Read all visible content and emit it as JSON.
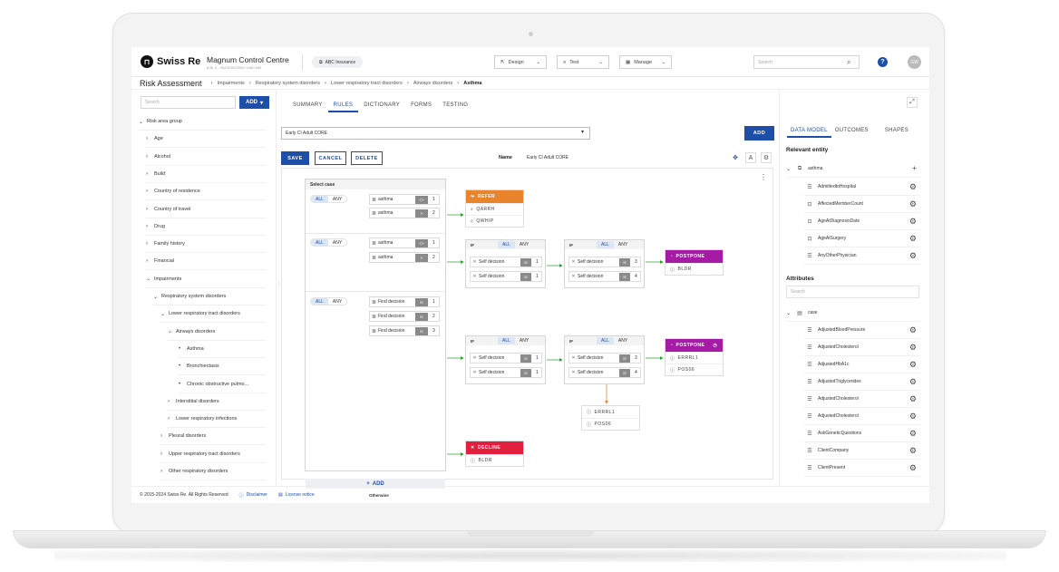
{
  "header": {
    "logo_text": "Swiss Re",
    "app_title": "Magnum Control Centre",
    "app_subtitle": "6.8L.3 - 20231002/200/+1440 ed2",
    "tenant": "ABC Insurance",
    "menus": [
      {
        "icon": "design-icon",
        "label": "Design"
      },
      {
        "icon": "test-icon",
        "label": "Test"
      },
      {
        "icon": "manage-icon",
        "label": "Manage"
      }
    ],
    "search_placeholder": "Search",
    "avatar_initials": "GW"
  },
  "breadcrumb": {
    "title": "Risk Assessment",
    "items": [
      "Impairments",
      "Respiratory system disorders",
      "Lower respiratory tract disorders",
      "Airways disorders",
      "Asthma"
    ]
  },
  "tree": {
    "search_placeholder": "Search",
    "add_label": "ADD",
    "items": [
      {
        "label": "Risk area group",
        "chev": "⌄"
      },
      {
        "label": "Age",
        "chev": "›"
      },
      {
        "label": "Alcohol",
        "chev": "›"
      },
      {
        "label": "Build",
        "chev": "›"
      },
      {
        "label": "Country of residence",
        "chev": "›"
      },
      {
        "label": "Country of travel",
        "chev": "›"
      },
      {
        "label": "Drug",
        "chev": "›"
      },
      {
        "label": "Family history",
        "chev": "›"
      },
      {
        "label": "Financial",
        "chev": "›"
      },
      {
        "label": "Impairments",
        "chev": "⌄"
      },
      {
        "label": "Respiratory system disorders",
        "chev": "⌄"
      },
      {
        "label": "Lower respiratory tract disorders",
        "chev": "⌄"
      },
      {
        "label": "Airways disorders",
        "chev": "⌄"
      },
      {
        "label": "Asthma",
        "chev": "•"
      },
      {
        "label": "Bronchiectasis",
        "chev": "•"
      },
      {
        "label": "Chronic obstructive pulmo...",
        "chev": "•"
      },
      {
        "label": "Interstitial disorders",
        "chev": "›"
      },
      {
        "label": "Lower respiratory infections",
        "chev": "›"
      },
      {
        "label": "Pleural disorders",
        "chev": "›"
      },
      {
        "label": "Upper respiratory tract disorders",
        "chev": "›"
      },
      {
        "label": "Other respiratory disorders",
        "chev": "›"
      }
    ]
  },
  "tabs": [
    "SUMMARY",
    "RULES",
    "DICTIONARY",
    "FORMS",
    "TESTING"
  ],
  "active_tab": "RULES",
  "rules": {
    "ruleset_value": "Early CI Adult CORE",
    "add_label": "ADD",
    "save_label": "SAVE",
    "cancel_label": "CANCEL",
    "delete_label": "DELETE",
    "name_label": "Name",
    "name_value": "Early CI Adult CORE"
  },
  "case_panel": {
    "title": "Select case",
    "all_label": "ALL",
    "any_label": "ANY",
    "groups": [
      {
        "conditions": [
          {
            "label": "asthma",
            "op": "<>",
            "num": "1"
          },
          {
            "label": "asthma",
            "op": ">",
            "num": "2"
          }
        ]
      },
      {
        "conditions": [
          {
            "label": "asthma",
            "op": "<>",
            "num": "1"
          },
          {
            "label": "asthma",
            "op": "<",
            "num": "2"
          }
        ]
      },
      {
        "conditions": [
          {
            "label": "Find decision",
            "op": "is",
            "num": "1"
          },
          {
            "label": "Find decision",
            "op": "is",
            "num": "2"
          },
          {
            "label": "Find decision",
            "op": "is",
            "num": "3"
          }
        ]
      }
    ],
    "add_label": "ADD",
    "otherwise_label": "Otherwise"
  },
  "if_blocks": {
    "if_label": "IF",
    "all_label": "ALL",
    "any_label": "ANY",
    "blocks": [
      {
        "rows": [
          {
            "label": "Self decision",
            "op": "is",
            "num": "1"
          },
          {
            "label": "Self decision",
            "op": "is",
            "num": "1"
          }
        ]
      },
      {
        "rows": [
          {
            "label": "Self decision",
            "op": "is",
            "num": "3"
          },
          {
            "label": "Self decision",
            "op": "is",
            "num": "4"
          }
        ]
      },
      {
        "rows": [
          {
            "label": "Self decision",
            "op": "is",
            "num": "1"
          },
          {
            "label": "Self decision",
            "op": "is",
            "num": "1"
          }
        ]
      },
      {
        "rows": [
          {
            "label": "Self decision",
            "op": "is",
            "num": "3"
          },
          {
            "label": "Self decision",
            "op": "is",
            "num": "4"
          }
        ]
      }
    ]
  },
  "outcomes": {
    "refer": {
      "label": "REFER",
      "items": [
        "QARRH",
        "QWHIP"
      ],
      "color": "#e8852c"
    },
    "postpone_1": {
      "label": "POSTPONE",
      "items": [
        "BLDR"
      ],
      "color": "#a51ba6"
    },
    "postpone_2": {
      "label": "POSTPONE",
      "items": [
        "ERRRL1",
        "POS06"
      ],
      "color": "#a51ba6"
    },
    "standalone": {
      "items": [
        "ERRRL1",
        "POS06"
      ]
    },
    "decline": {
      "label": "DECLINE",
      "items": [
        "BLDR"
      ],
      "color": "#e0203c"
    }
  },
  "right_panel": {
    "tabs": [
      "DATA MODEL",
      "OUTCOMES",
      "SHAPES"
    ],
    "active_tab": "DATA MODEL",
    "relevant_entity_title": "Relevant entity",
    "entity_root": "asthma",
    "entity_items": [
      {
        "icon": "list-icon",
        "label": "AdmittedtoHospital"
      },
      {
        "icon": "number-icon",
        "label": "AffectedMemberCount"
      },
      {
        "icon": "number-icon",
        "label": "AgeAtDiagnosisDate"
      },
      {
        "icon": "number-icon",
        "label": "AgeAtSurgery"
      },
      {
        "icon": "list-icon",
        "label": "AnyOtherPhysician"
      }
    ],
    "attributes_title": "Attributes",
    "attr_search_placeholder": "Search",
    "attr_root": "case",
    "attr_items": [
      "AdjustedBloodPressure",
      "AdjustedCholesterol",
      "AdjustedHbA1c",
      "AdjustedTriglycerides",
      "AdjustedCholesterol",
      "AdjustedCholesterol",
      "AskGeneticQuestions",
      "ClientCompany",
      "ClientPresent"
    ]
  },
  "footer": {
    "copyright": "© 2015-2024 Swiss Re. All Rights Reserved",
    "disclaimer": "Disclaimer",
    "license": "License notice"
  },
  "colors": {
    "primary": "#1e4fa8",
    "refer": "#e8852c",
    "postpone": "#a51ba6",
    "decline": "#e0203c",
    "connector": "#2ca02c",
    "connector_alt": "#e8852c"
  }
}
